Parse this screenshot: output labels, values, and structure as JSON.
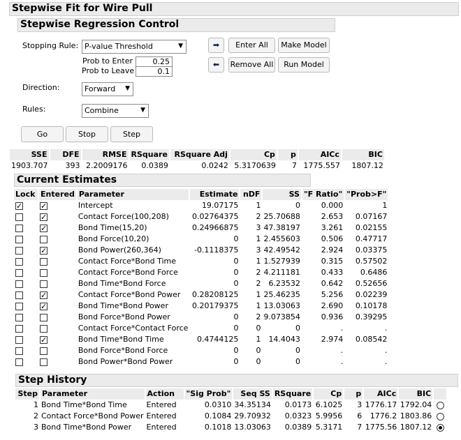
{
  "title": "Stepwise Fit for Wire Pull",
  "control": {
    "title": "Stepwise Regression Control",
    "stopping_rule_label": "Stopping Rule:",
    "stopping_rule_value": "P-value Threshold",
    "prob_enter_label": "Prob to Enter",
    "prob_enter_value": "0.25",
    "prob_leave_label": "Prob to Leave",
    "prob_leave_value": "0.1",
    "direction_label": "Direction:",
    "direction_value": "Forward",
    "rules_label": "Rules:",
    "rules_value": "Combine",
    "enter_all": "Enter All",
    "remove_all": "Remove All",
    "make_model": "Make Model",
    "run_model": "Run Model",
    "go": "Go",
    "stop": "Stop",
    "step": "Step",
    "arrow_right": "➡",
    "arrow_left": "⬅"
  },
  "stats": {
    "headers": [
      "SSE",
      "DFE",
      "RMSE",
      "RSquare",
      "RSquare Adj",
      "Cp",
      "p",
      "AICc",
      "BIC"
    ],
    "values": [
      "1903.707",
      "393",
      "2.2009176",
      "0.0389",
      "0.0242",
      "5.3170639",
      "7",
      "1775.557",
      "1807.12"
    ]
  },
  "estimates": {
    "title": "Current Estimates",
    "headers": [
      "Lock",
      "Entered",
      "Parameter",
      "Estimate",
      "nDF",
      "SS",
      "\"F Ratio\"",
      "\"Prob>F\""
    ],
    "rows": [
      {
        "lock": true,
        "entered": true,
        "parameter": "Intercept",
        "estimate": "19.07175",
        "ndf": "1",
        "ss": "0",
        "f": "0.000",
        "p": "1"
      },
      {
        "lock": false,
        "entered": true,
        "parameter": "Contact Force(100,208)",
        "estimate": "0.02764375",
        "ndf": "2",
        "ss": "25.70688",
        "f": "2.653",
        "p": "0.07167"
      },
      {
        "lock": false,
        "entered": true,
        "parameter": "Bond Time(15,20)",
        "estimate": "0.24966875",
        "ndf": "3",
        "ss": "47.38197",
        "f": "3.261",
        "p": "0.02155"
      },
      {
        "lock": false,
        "entered": false,
        "parameter": "Bond Force(10,20)",
        "estimate": "0",
        "ndf": "1",
        "ss": "2.455603",
        "f": "0.506",
        "p": "0.47717"
      },
      {
        "lock": false,
        "entered": true,
        "parameter": "Bond Power(260,364)",
        "estimate": "-0.1118375",
        "ndf": "3",
        "ss": "42.49542",
        "f": "2.924",
        "p": "0.03375"
      },
      {
        "lock": false,
        "entered": false,
        "parameter": "Contact Force*Bond Time",
        "estimate": "0",
        "ndf": "1",
        "ss": "1.527939",
        "f": "0.315",
        "p": "0.57502"
      },
      {
        "lock": false,
        "entered": false,
        "parameter": "Contact Force*Bond Force",
        "estimate": "0",
        "ndf": "2",
        "ss": "4.211181",
        "f": "0.433",
        "p": "0.6486"
      },
      {
        "lock": false,
        "entered": false,
        "parameter": "Bond Time*Bond Force",
        "estimate": "0",
        "ndf": "2",
        "ss": "6.23532",
        "f": "0.642",
        "p": "0.52656"
      },
      {
        "lock": false,
        "entered": true,
        "parameter": "Contact Force*Bond Power",
        "estimate": "0.28208125",
        "ndf": "1",
        "ss": "25.46235",
        "f": "5.256",
        "p": "0.02239"
      },
      {
        "lock": false,
        "entered": true,
        "parameter": "Bond Time*Bond Power",
        "estimate": "0.20179375",
        "ndf": "1",
        "ss": "13.03063",
        "f": "2.690",
        "p": "0.10178"
      },
      {
        "lock": false,
        "entered": false,
        "parameter": "Bond Force*Bond Power",
        "estimate": "0",
        "ndf": "2",
        "ss": "9.073854",
        "f": "0.936",
        "p": "0.39295"
      },
      {
        "lock": false,
        "entered": false,
        "parameter": "Contact Force*Contact Force",
        "estimate": "0",
        "ndf": "0",
        "ss": "0",
        "f": ".",
        "p": "."
      },
      {
        "lock": false,
        "entered": true,
        "parameter": "Bond Time*Bond Time",
        "estimate": "0.4744125",
        "ndf": "1",
        "ss": "14.4043",
        "f": "2.974",
        "p": "0.08542"
      },
      {
        "lock": false,
        "entered": false,
        "parameter": "Bond Force*Bond Force",
        "estimate": "0",
        "ndf": "0",
        "ss": "0",
        "f": ".",
        "p": "."
      },
      {
        "lock": false,
        "entered": false,
        "parameter": "Bond Power*Bond Power",
        "estimate": "0",
        "ndf": "0",
        "ss": "0",
        "f": ".",
        "p": "."
      }
    ]
  },
  "history": {
    "title": "Step History",
    "headers": [
      "Step",
      "Parameter",
      "Action",
      "\"Sig Prob\"",
      "Seq SS",
      "RSquare",
      "Cp",
      "p",
      "AICc",
      "BIC"
    ],
    "rows": [
      {
        "step": "1",
        "parameter": "Bond Time*Bond Time",
        "action": "Entered",
        "sig": "0.0310",
        "seqss": "34.35134",
        "rsq": "0.0173",
        "cp": "6.1025",
        "p": "3",
        "aicc": "1776.17",
        "bic": "1792.04",
        "selected": false
      },
      {
        "step": "2",
        "parameter": "Contact Force*Bond Power",
        "action": "Entered",
        "sig": "0.1084",
        "seqss": "29.70932",
        "rsq": "0.0323",
        "cp": "5.9956",
        "p": "6",
        "aicc": "1776.2",
        "bic": "1803.86",
        "selected": false
      },
      {
        "step": "3",
        "parameter": "Bond Time*Bond Power",
        "action": "Entered",
        "sig": "0.1018",
        "seqss": "13.03063",
        "rsq": "0.0389",
        "cp": "5.3171",
        "p": "7",
        "aicc": "1775.56",
        "bic": "1807.12",
        "selected": true
      }
    ]
  }
}
